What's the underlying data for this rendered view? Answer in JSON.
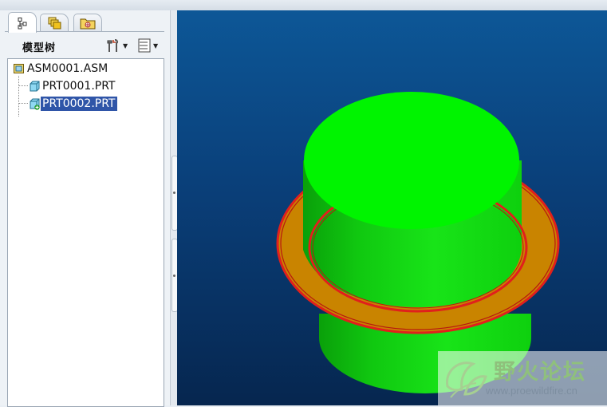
{
  "tabs": [
    {
      "name": "model-tree-tab",
      "icon": "model-tree-icon",
      "active": true
    },
    {
      "name": "layers-tab",
      "icon": "layers-icon",
      "active": false
    },
    {
      "name": "folder-browser-tab",
      "icon": "folder-icon",
      "active": false
    }
  ],
  "tree": {
    "title": "模型树",
    "settings_icon": "tools-icon",
    "show_icon": "list-icon",
    "items": [
      {
        "label": "ASM0001.ASM",
        "icon": "assembly-icon",
        "selected": false
      },
      {
        "label": "PRT0001.PRT",
        "icon": "part-icon",
        "selected": false
      },
      {
        "label": "PRT0002.PRT",
        "icon": "part-new-icon",
        "selected": true
      }
    ]
  },
  "viewport": {
    "colors": {
      "background_top": "#0d5797",
      "background_bottom": "#06264f",
      "cylinder": "#00ee00",
      "ring": "#c98400",
      "ring_edge": "#e0201c"
    }
  },
  "watermark": {
    "title": "野火论坛",
    "url": "www.proewildfire.cn"
  }
}
